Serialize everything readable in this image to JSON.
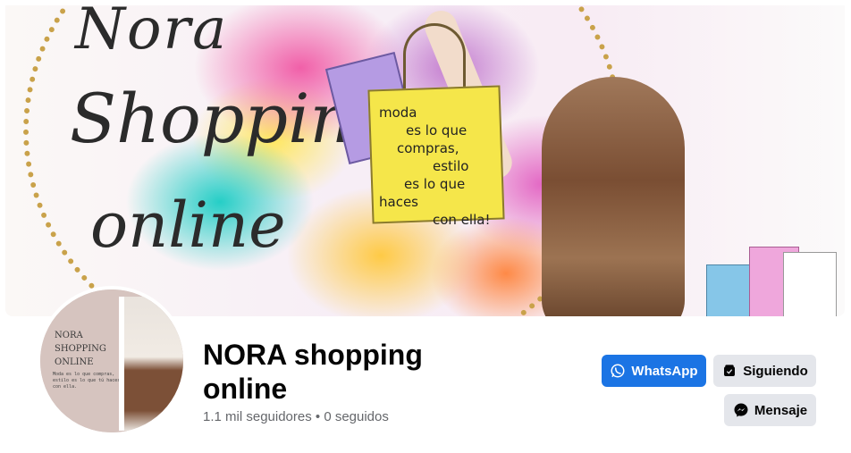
{
  "cover": {
    "script_lines": [
      "Nora",
      "Shoppin",
      "online"
    ],
    "bag_text": [
      "moda",
      "es lo que",
      "compras,",
      "estilo",
      "es lo que",
      "haces",
      "con ella!"
    ]
  },
  "avatar": {
    "title_lines": [
      "NORA",
      "SHOPPING",
      "ONLINE"
    ],
    "small_text": "Moda es lo que compras, estilo es lo que tú haces con ella."
  },
  "page": {
    "name": "NORA shopping online",
    "followers": "1.1 mil seguidores • 0 seguidos"
  },
  "actions": {
    "whatsapp": {
      "label": "WhatsApp",
      "icon": "whatsapp-icon"
    },
    "following": {
      "label": "Siguiendo",
      "icon": "following-icon"
    },
    "message": {
      "label": "Mensaje",
      "icon": "messenger-icon"
    }
  },
  "colors": {
    "primary_button": "#1b74e4",
    "secondary_button": "#e4e6eb",
    "muted_text": "#65676b"
  }
}
